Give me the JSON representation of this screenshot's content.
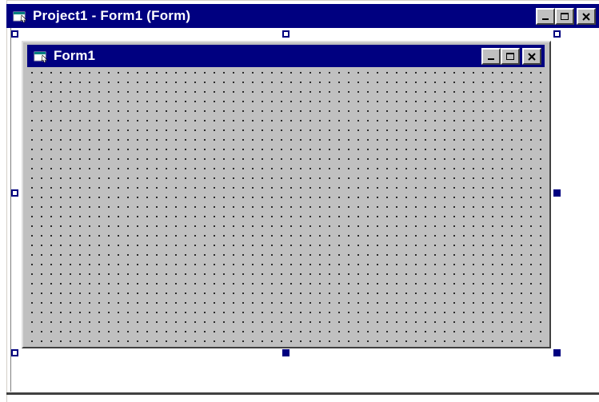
{
  "outer_window": {
    "title": "Project1 - Form1 (Form)",
    "icon": "form-icon",
    "caption_buttons": [
      "minimize",
      "maximize",
      "close"
    ]
  },
  "form": {
    "title": "Form1",
    "icon": "form-icon",
    "caption_buttons": [
      "minimize",
      "maximize",
      "close"
    ],
    "grid": true
  },
  "colors": {
    "titlebar": "#000080",
    "form_background": "#c0c0c0",
    "handle": "#000080"
  }
}
